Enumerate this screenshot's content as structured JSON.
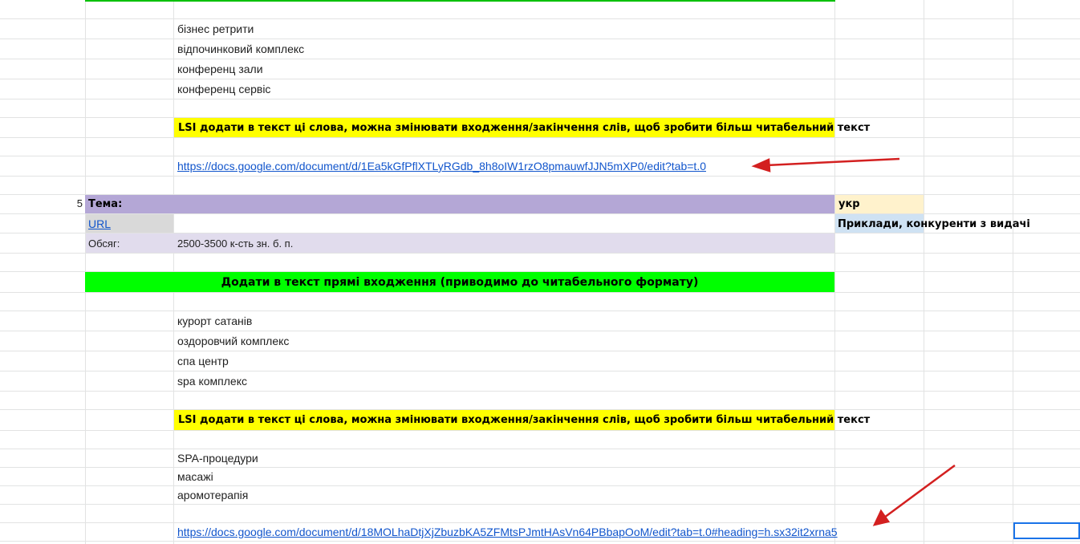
{
  "colors": {
    "yellow": "#ffff00",
    "bright_green": "#00ff00",
    "purple_header": "#b4a7d6",
    "lavender": "#e1dced",
    "light_gray": "#d9d9d9",
    "light_orange": "#fff2cc",
    "light_blue": "#cfe2f3",
    "link": "#1155cc",
    "arrow": "#d32020",
    "selection": "#1a73e8"
  },
  "section1": {
    "keywords": [
      "бізнес ретрити",
      "відпочинковий комплекс",
      "конференц зали",
      "конференц сервіс"
    ],
    "lsi_banner": "LSI додати в текст ці слова, можна змінювати входження/закінчення слів, щоб зробити більш читабельний текст",
    "doc_link": "https://docs.google.com/document/d/1Ea5kGfPflXTLyRGdb_8h8oIW1rzO8pmauwfJJN5mXP0/edit?tab=t.0"
  },
  "section2": {
    "row_number": "5",
    "topic_label": "Тема:",
    "lang_label": "укр",
    "url_label": "URL",
    "examples_label": "Приклади, конкуренти з видачі",
    "volume_label": "Обсяг:",
    "volume_value": "2500-3500 к-сть зн. б. п.",
    "direct_banner": "Додати в текст прямі входження (приводимо до читабельного формату)",
    "keywords": [
      "курорт сатанів",
      "оздоровчий комплекс",
      "спа центр",
      "spa комплекс"
    ],
    "lsi_banner": "LSI додати в текст ці слова, можна змінювати входження/закінчення слів, щоб зробити більш читабельний текст",
    "lsi_words": [
      "SPA-процедури",
      "масажі",
      "аромотерапія"
    ],
    "doc_link": "https://docs.google.com/document/d/18MOLhaDtjXjZbuzbKA5ZFMtsPJmtHAsVn64PBbapOoM/edit?tab=t.0#heading=h.sx32it2xrna5"
  }
}
